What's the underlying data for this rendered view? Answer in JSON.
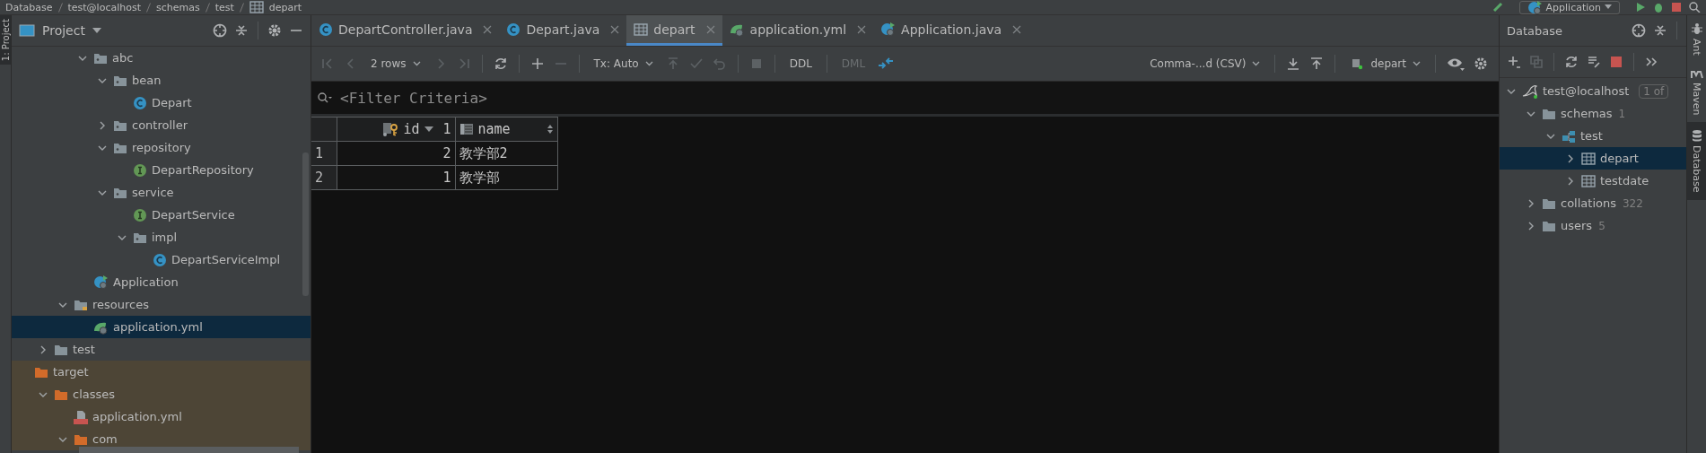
{
  "breadcrumbs": [
    "Database",
    "test@localhost",
    "schemas",
    "test",
    "depart"
  ],
  "run_config": {
    "label": "Application"
  },
  "left_stripe": [
    {
      "label": "1: Project",
      "selected": true
    }
  ],
  "project_panel": {
    "title": "Project",
    "sections": [
      {
        "kind": "package",
        "nodes": [
          {
            "label": "abc",
            "kind": "package",
            "expanded": true,
            "selected": false,
            "children": [
              {
                "label": "bean",
                "kind": "package",
                "expanded": true,
                "selected": false,
                "children": [
                  {
                    "label": "Depart",
                    "kind": "class",
                    "selected": false
                  }
                ]
              },
              {
                "label": "controller",
                "kind": "package",
                "expanded": false,
                "selected": false
              },
              {
                "label": "repository",
                "kind": "package",
                "expanded": true,
                "selected": false,
                "children": [
                  {
                    "label": "DepartRepository",
                    "kind": "interface",
                    "selected": false
                  }
                ]
              },
              {
                "label": "service",
                "kind": "package",
                "expanded": true,
                "selected": false,
                "children": [
                  {
                    "label": "DepartService",
                    "kind": "interface",
                    "selected": false
                  },
                  {
                    "label": "impl",
                    "kind": "package",
                    "expanded": true,
                    "selected": false,
                    "children": [
                      {
                        "label": "DepartServiceImpl",
                        "kind": "class",
                        "selected": false
                      }
                    ]
                  }
                ]
              }
            ]
          },
          {
            "label": "Application",
            "kind": "spring-app",
            "selected": false
          }
        ]
      },
      {
        "kind": "source-root",
        "nodes": [
          {
            "label": "resources",
            "kind": "resources",
            "expanded": true,
            "selected": false,
            "children": [
              {
                "label": "application.yml",
                "kind": "spring-yml",
                "selected": true
              }
            ]
          }
        ]
      },
      {
        "kind": "module",
        "nodes": [
          {
            "label": "test",
            "kind": "folder",
            "expanded": false,
            "selected": false,
            "excluded": false
          }
        ]
      },
      {
        "kind": "output",
        "nodes": [
          {
            "label": "target",
            "kind": "excluded-folder",
            "selected": false,
            "excluded": true,
            "children": [
              {
                "label": "classes",
                "kind": "excluded-folder",
                "expanded": true,
                "selected": false,
                "children": [
                  {
                    "label": "application.yml",
                    "kind": "yml",
                    "selected": false
                  },
                  {
                    "label": "com",
                    "kind": "excluded-folder",
                    "expanded": true,
                    "selected": false
                  }
                ]
              }
            ]
          }
        ]
      }
    ]
  },
  "editor_tabs": [
    {
      "label": "DepartController.java",
      "kind": "class",
      "selected": false
    },
    {
      "label": "Depart.java",
      "kind": "class",
      "selected": false
    },
    {
      "label": "depart",
      "kind": "table",
      "selected": true
    },
    {
      "label": "application.yml",
      "kind": "spring-yml",
      "selected": false
    },
    {
      "label": "Application.java",
      "kind": "spring-app",
      "selected": false
    }
  ],
  "toolbar": {
    "rows": "2 rows",
    "tx": "Tx: Auto",
    "buttons": [
      {
        "label": "DDL",
        "disabled": false
      },
      {
        "label": "DML",
        "disabled": true
      }
    ],
    "export_format": "Comma-...d (CSV)",
    "datasource": "depart"
  },
  "filter": {
    "placeholder": "<Filter Criteria>"
  },
  "grid": {
    "columns": [
      {
        "name": "id",
        "kind": "primary-key",
        "sorted_descending": true,
        "sort_order": "1"
      },
      {
        "name": "name",
        "kind": "column",
        "sorted_descending": false
      }
    ],
    "rows": [
      {
        "number": "1",
        "cells": [
          "2",
          "教学部2"
        ]
      },
      {
        "number": "2",
        "cells": [
          "1",
          "教学部"
        ]
      }
    ]
  },
  "database_panel": {
    "title": "Database",
    "tree": [
      {
        "label": "test@localhost",
        "kind": "datasource",
        "badge": "1 of",
        "expanded": true,
        "selected": false,
        "children": [
          {
            "label": "schemas",
            "kind": "folder",
            "count": "1",
            "expanded": true,
            "selected": false,
            "children": [
              {
                "label": "test",
                "kind": "schema",
                "expanded": true,
                "selected": false,
                "children": [
                  {
                    "label": "depart",
                    "kind": "table",
                    "expanded": false,
                    "selected": true
                  },
                  {
                    "label": "testdate",
                    "kind": "table",
                    "expanded": false,
                    "selected": false
                  }
                ]
              }
            ]
          },
          {
            "label": "collations",
            "kind": "folder",
            "count": "322",
            "expanded": false,
            "selected": false
          },
          {
            "label": "users",
            "kind": "folder",
            "count": "5",
            "expanded": false,
            "selected": false
          }
        ]
      }
    ]
  },
  "right_stripe": [
    {
      "label": "Ant",
      "kind": "ant",
      "selected": false
    },
    {
      "label": "Maven",
      "kind": "maven",
      "selected": false
    },
    {
      "label": "Database",
      "kind": "database",
      "selected": true
    }
  ]
}
